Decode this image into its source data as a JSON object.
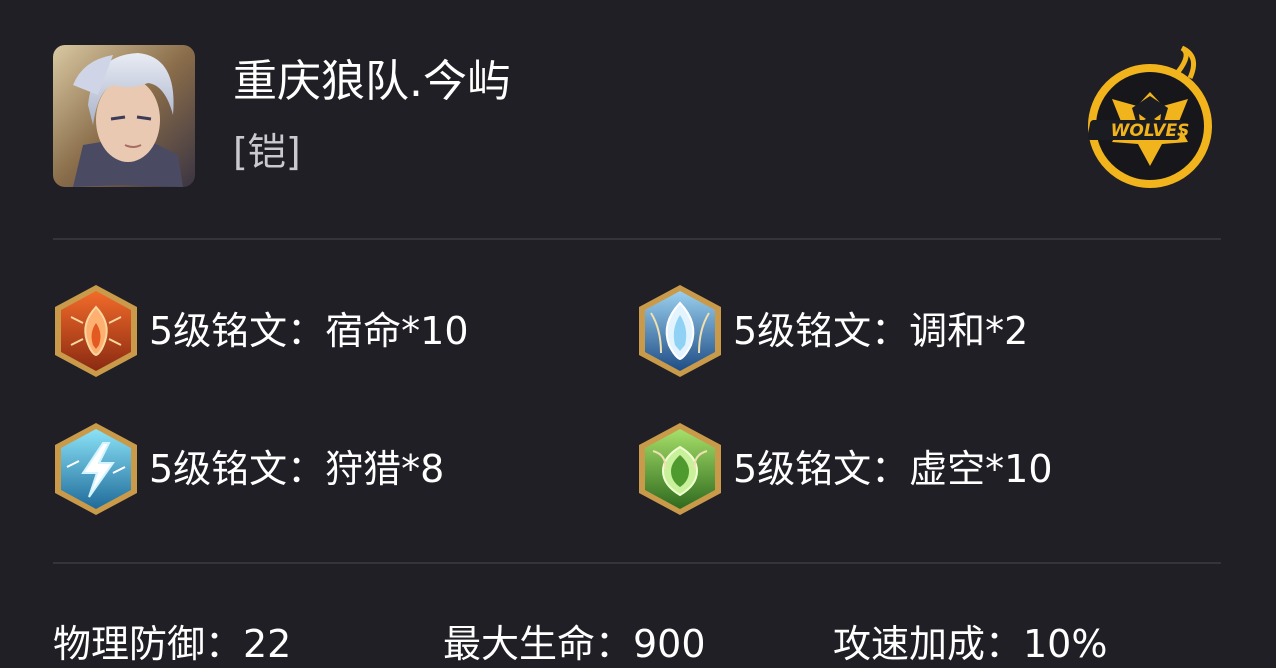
{
  "player": {
    "name": "重庆狼队.今屿",
    "hero": "[铠]",
    "avatar_icon": "hero-portrait-icon",
    "team_logo_icon": "wolves-logo-icon",
    "team_logo_text": "WOLVES"
  },
  "runes": [
    {
      "text": "5级铭文：宿命*10",
      "icon": "fire-rune-icon",
      "color": "#c94a1c"
    },
    {
      "text": "5级铭文：调和*2",
      "icon": "crystal-rune-icon",
      "color": "#3e6fa8"
    },
    {
      "text": "5级铭文：狩猎*8",
      "icon": "lightning-rune-icon",
      "color": "#3aa6c9"
    },
    {
      "text": "5级铭文：虚空*10",
      "icon": "leaf-rune-icon",
      "color": "#6bb23a"
    }
  ],
  "stats": [
    {
      "text": "物理防御：22"
    },
    {
      "text": "最大生命：900"
    },
    {
      "text": "攻速加成：10%"
    }
  ],
  "colors": {
    "background": "#1f1f25",
    "divider": "#34343d",
    "accent": "#f2b41c"
  }
}
